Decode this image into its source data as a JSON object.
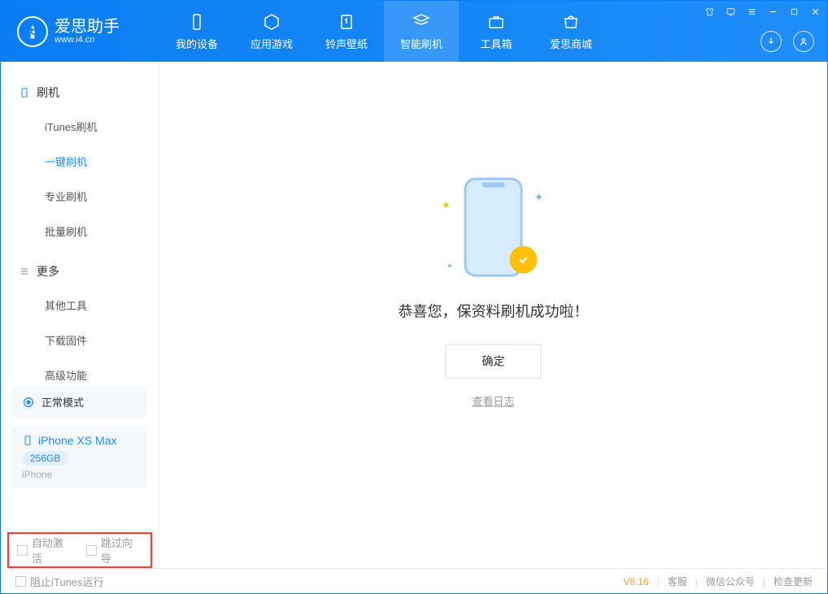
{
  "app": {
    "name": "爱思助手",
    "url": "www.i4.cn"
  },
  "tabs": {
    "device": "我的设备",
    "apps": "应用游戏",
    "ringtone": "铃声壁纸",
    "flash": "智能刷机",
    "tools": "工具箱",
    "store": "爱思商城"
  },
  "sidebar": {
    "group_flash": "刷机",
    "items_flash": {
      "itunes": "iTunes刷机",
      "one_click": "一键刷机",
      "pro": "专业刷机",
      "batch": "批量刷机"
    },
    "group_more": "更多",
    "items_more": {
      "other_tools": "其他工具",
      "download_fw": "下载固件",
      "advanced": "高级功能"
    }
  },
  "device_panel": {
    "mode": "正常模式",
    "name": "iPhone XS Max",
    "storage": "256GB",
    "type": "iPhone"
  },
  "bottom_checks": {
    "auto_activate": "自动激活",
    "skip_guide": "跳过向导"
  },
  "main": {
    "success_msg": "恭喜您，保资料刷机成功啦！",
    "ok_btn": "确定",
    "view_log": "查看日志"
  },
  "statusbar": {
    "block_itunes": "阻止iTunes运行",
    "version": "V8.16",
    "support": "客服",
    "wechat": "微信公众号",
    "update": "检查更新"
  }
}
